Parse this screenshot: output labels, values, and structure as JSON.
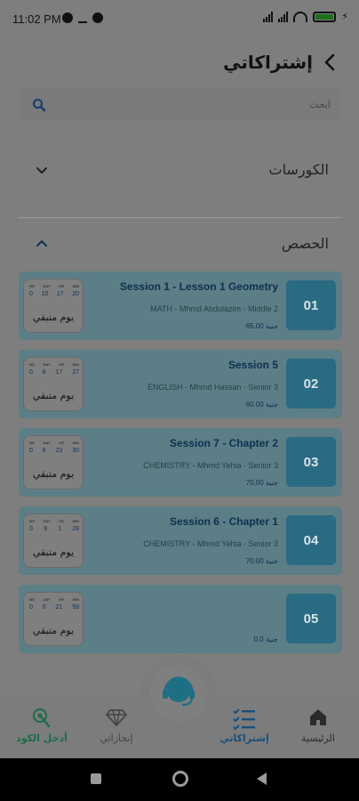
{
  "status_bar": {
    "time": "11:02 PM"
  },
  "header": {
    "title": "إشتراكاتي"
  },
  "search": {
    "placeholder": "ابحث"
  },
  "sections": {
    "courses_label": "الكورسات",
    "sessions_label": "الحصص"
  },
  "timer_units": {
    "day": "DAY",
    "hr": "HR",
    "min": "MIN",
    "no": "NO"
  },
  "sessions": [
    {
      "number": "01",
      "title": "Session 1 - Lesson 1 Geometry",
      "subtitle": "MATH - Mhmd Abdulazim - Middle 2",
      "price": "65.00 جنية",
      "timer": {
        "a": "0",
        "b": "10",
        "c": "17",
        "d": "20"
      },
      "remaining": "يوم متبقي"
    },
    {
      "number": "02",
      "title": "Session 5",
      "subtitle": "ENGLISH - Mhmd Hassan - Senior 3",
      "price": "60.00 جنية",
      "timer": {
        "a": "0",
        "b": "8",
        "c": "17",
        "d": "27"
      },
      "remaining": "يوم متبقي"
    },
    {
      "number": "03",
      "title": "Session 7 - Chapter 2",
      "subtitle": "CHEMISTRY - Mhmd Yehia - Senior 3",
      "price": "70.00 جنية",
      "timer": {
        "a": "0",
        "b": "8",
        "c": "23",
        "d": "30"
      },
      "remaining": "يوم متبقي"
    },
    {
      "number": "04",
      "title": "Session 6 - Chapter 1",
      "subtitle": "CHEMISTRY - Mhmd Yehia - Senior 3",
      "price": "70.00 جنية",
      "timer": {
        "a": "0",
        "b": "9",
        "c": "1",
        "d": "28"
      },
      "remaining": "يوم متبقي"
    },
    {
      "number": "05",
      "title": "",
      "subtitle": "",
      "price": "0.0 جنية",
      "timer": {
        "a": "0",
        "b": "0",
        "c": "21",
        "d": "59"
      },
      "remaining": "يوم متبقي"
    }
  ],
  "bottom_nav": {
    "home": "الرئيسية",
    "subscriptions": "إشتراكاتي",
    "achievements": "إنجازاتي",
    "enter_code": "أدخل الكود"
  },
  "colors": {
    "accent": "#2a6b84",
    "active_nav": "#1a4f7a",
    "code_green": "#1d6b4a"
  }
}
